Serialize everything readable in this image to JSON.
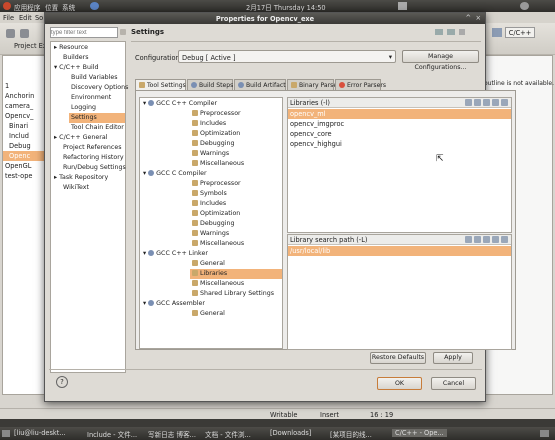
{
  "top_panel": {
    "apps": "应用程序",
    "places": "位置",
    "system": "系统",
    "datetime": "2月17日 Thursday 14:50"
  },
  "eclipse": {
    "menu": [
      "File",
      "Edit",
      "So"
    ],
    "left_tab": "Project Expl",
    "left_items": [
      "1",
      "Anchorin",
      "camera_",
      "Opencv_",
      "Binari",
      "Includ",
      "Debug",
      "Openc",
      "OpenGL",
      "test-ope"
    ],
    "perspective": "C/C++",
    "right_text": "outline is not available.",
    "status": {
      "mode": "Writable",
      "insert": "Insert",
      "position": "16 : 19"
    }
  },
  "dialog": {
    "title": "Properties for Opencv_exe",
    "filter_placeholder": "type filter text",
    "nav": [
      "Resource",
      "Builders",
      "C/C++ Build",
      "Build Variables",
      "Discovery Options",
      "Environment",
      "Logging",
      "Settings",
      "Tool Chain Editor",
      "C/C++ General",
      "Project References",
      "Refactoring History",
      "Run/Debug Settings",
      "Task Repository",
      "WikiText"
    ],
    "page_title": "Settings",
    "configuration_label": "Configuration:",
    "configuration_value": "Debug [ Active ]",
    "manage_button": "Manage Configurations...",
    "tabs": [
      "Tool Settings",
      "Build Steps",
      "Build Artifact",
      "Binary Parsers",
      "Error Parsers"
    ],
    "tool_tree": [
      {
        "label": "GCC C++ Compiler",
        "level": 0,
        "cat": true
      },
      {
        "label": "Preprocessor",
        "level": 1
      },
      {
        "label": "Includes",
        "level": 1
      },
      {
        "label": "Optimization",
        "level": 1
      },
      {
        "label": "Debugging",
        "level": 1
      },
      {
        "label": "Warnings",
        "level": 1
      },
      {
        "label": "Miscellaneous",
        "level": 1
      },
      {
        "label": "GCC C Compiler",
        "level": 0,
        "cat": true
      },
      {
        "label": "Preprocessor",
        "level": 1
      },
      {
        "label": "Symbols",
        "level": 1
      },
      {
        "label": "Includes",
        "level": 1
      },
      {
        "label": "Optimization",
        "level": 1
      },
      {
        "label": "Debugging",
        "level": 1
      },
      {
        "label": "Warnings",
        "level": 1
      },
      {
        "label": "Miscellaneous",
        "level": 1
      },
      {
        "label": "GCC C++ Linker",
        "level": 0,
        "cat": true
      },
      {
        "label": "General",
        "level": 1
      },
      {
        "label": "Libraries",
        "level": 1,
        "selected": true
      },
      {
        "label": "Miscellaneous",
        "level": 1
      },
      {
        "label": "Shared Library Settings",
        "level": 1
      },
      {
        "label": "GCC Assembler",
        "level": 0,
        "cat": true
      },
      {
        "label": "General",
        "level": 1
      }
    ],
    "libraries_header": "Libraries (-l)",
    "libraries": [
      "opencv_ml",
      "opencv_imgproc",
      "opencv_core",
      "opencv_highgui"
    ],
    "library_path_header": "Library search path (-L)",
    "library_paths": [
      "/usr/local/lib"
    ],
    "restore_button": "Restore Defaults",
    "apply_button": "Apply",
    "ok_button": "OK",
    "cancel_button": "Cancel",
    "help_icon": "?"
  },
  "taskbar": [
    "[liu@liu-deskt...",
    "Include - 文件...",
    "写新日志 博客...",
    "文档 - 文件浏...",
    "[Downloads]",
    "[某项目的线...",
    "C/C++ - Ope..."
  ]
}
